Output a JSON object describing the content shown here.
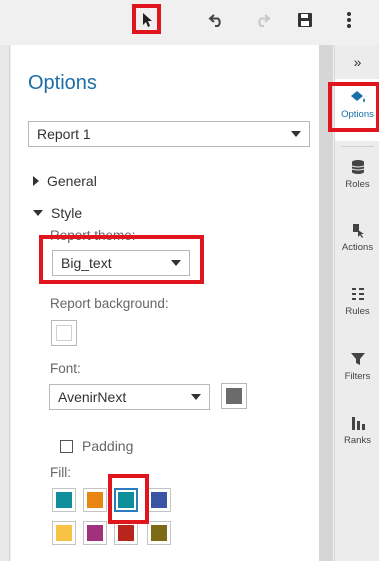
{
  "toolbar": {
    "buttons": [
      "pointer-icon",
      "undo-icon",
      "redo-icon",
      "save-icon",
      "more-vertical-icon"
    ]
  },
  "panel": {
    "title": "Options",
    "object_select": {
      "value": "Report 1"
    },
    "sections": {
      "general": "General",
      "style": "Style"
    },
    "report_theme": {
      "label": "Report theme:",
      "value": "Big_text"
    },
    "report_background": {
      "label": "Report background:",
      "color": "#ffffff"
    },
    "font": {
      "label": "Font:",
      "value": "AvenirNext",
      "color": "#6b6b6b"
    },
    "padding": {
      "label": "Padding",
      "checked": false
    },
    "fill": {
      "label": "Fill:",
      "swatches": [
        "#0d8f9a",
        "#ea860f",
        "#0d8f9a",
        "#3a55a4",
        "#f8c342",
        "#a1317a",
        "#b8251c",
        "#7d6a14"
      ]
    }
  },
  "rail": {
    "collapse_glyph": "»",
    "items": [
      {
        "label": "Options",
        "active": true
      },
      {
        "label": "Roles"
      },
      {
        "label": "Actions"
      },
      {
        "label": "Rules"
      },
      {
        "label": "Filters"
      },
      {
        "label": "Ranks"
      }
    ]
  }
}
